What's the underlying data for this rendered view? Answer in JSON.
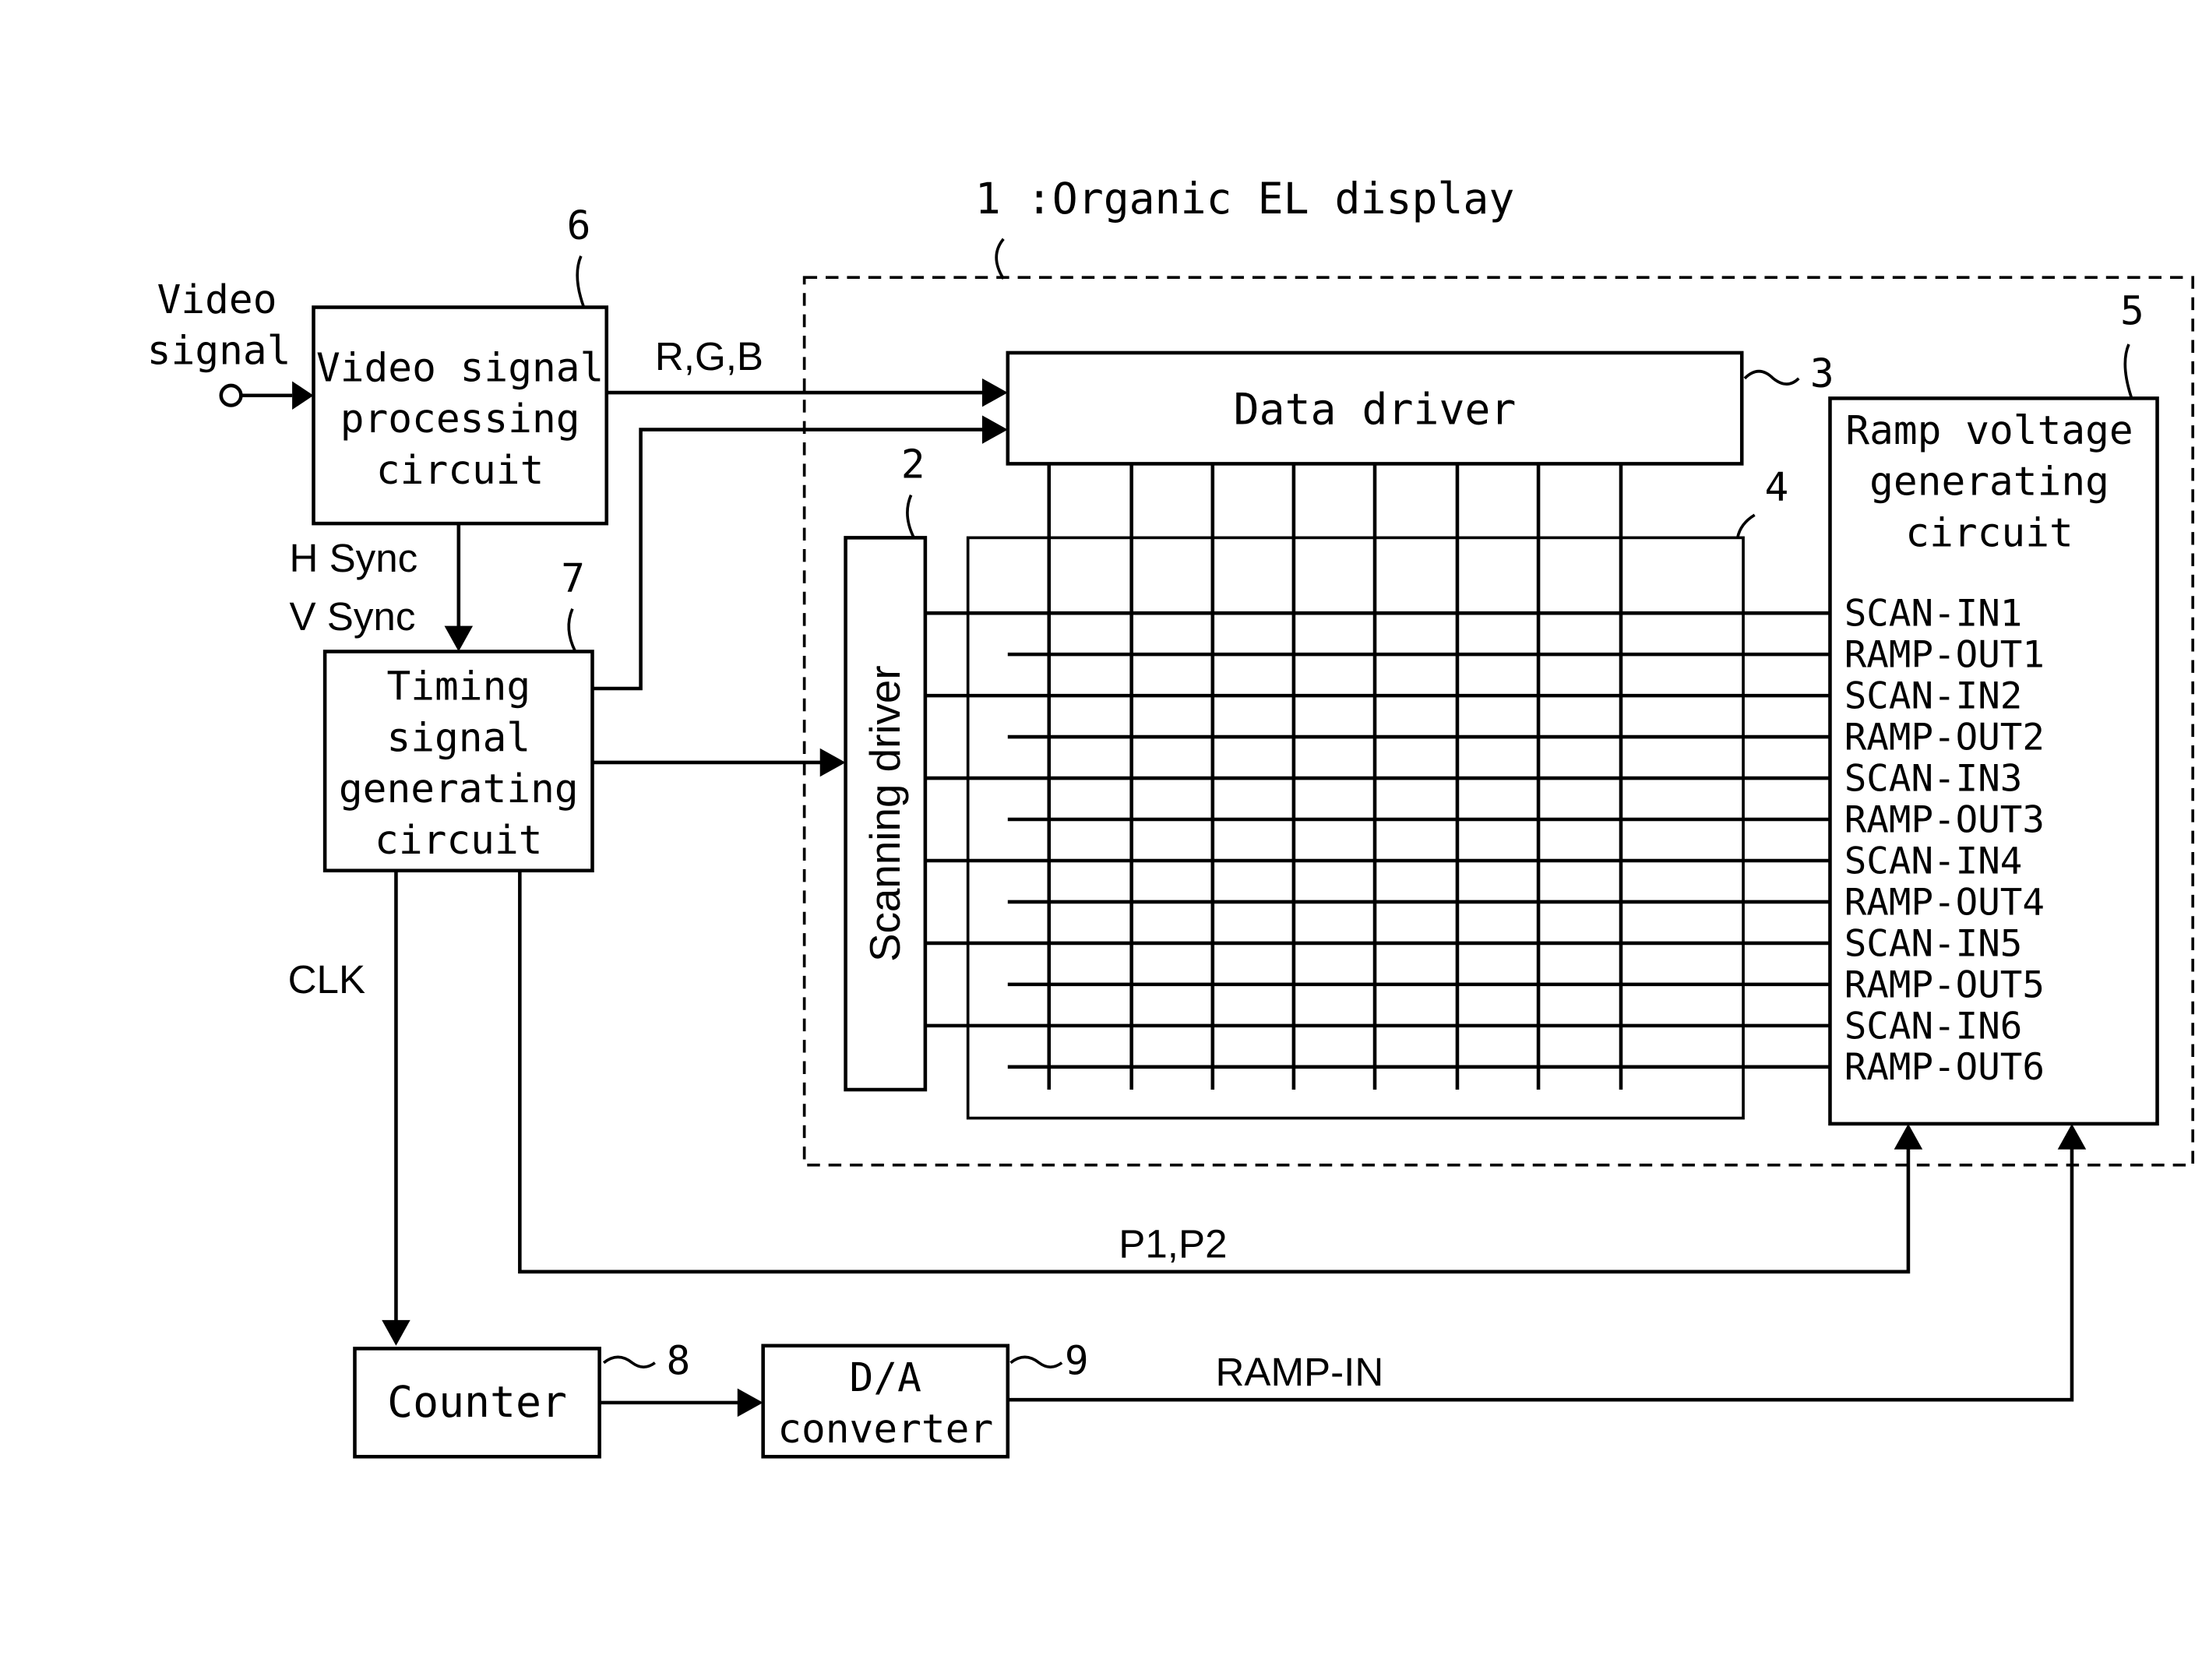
{
  "title": "1 :Organic EL display",
  "input": {
    "label_line1": "Video",
    "label_line2": "signal"
  },
  "blocks": {
    "video_proc": {
      "ref": "6",
      "lines": [
        "Video signal",
        "processing",
        "circuit"
      ]
    },
    "timing": {
      "ref": "7",
      "lines": [
        "Timing",
        "signal",
        "generating",
        "circuit"
      ]
    },
    "data_driver": {
      "ref": "3",
      "label": "Data driver"
    },
    "scanning_driver": {
      "ref": "2",
      "label": "Scanning driver"
    },
    "panel": {
      "ref": "4"
    },
    "ramp_gen": {
      "ref": "5",
      "lines": [
        "Ramp voltage",
        "generating",
        "circuit"
      ]
    },
    "counter": {
      "ref": "8",
      "label": "Counter"
    },
    "dac": {
      "ref": "9",
      "lines": [
        "D/A",
        "converter"
      ]
    }
  },
  "signals": {
    "rgb": "R,G,B",
    "hsync": "H Sync",
    "vsync": "V Sync",
    "clk": "CLK",
    "p1p2": "P1,P2",
    "ramp_in": "RAMP-IN"
  },
  "ramp_ports": [
    "SCAN-IN1",
    "RAMP-OUT1",
    "SCAN-IN2",
    "RAMP-OUT2",
    "SCAN-IN3",
    "RAMP-OUT3",
    "SCAN-IN4",
    "RAMP-OUT4",
    "SCAN-IN5",
    "RAMP-OUT5",
    "SCAN-IN6",
    "RAMP-OUT6"
  ]
}
